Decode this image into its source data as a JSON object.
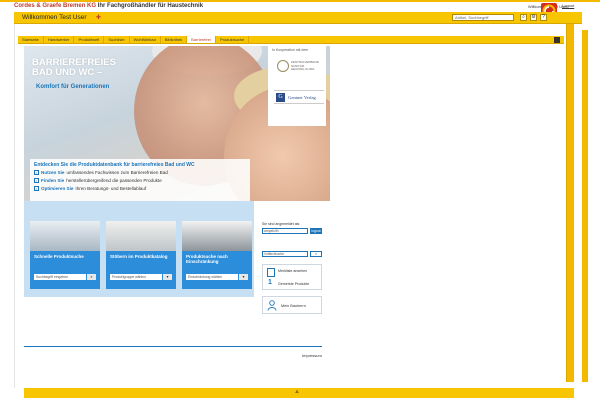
{
  "header": {
    "brand_name": "Cordes & Graefe Bremen KG",
    "brand_tagline": "Ihr Fachgroßhändler für Haustechnik",
    "login_status": "Willkommen Test User",
    "logout_label": "Logout",
    "welcome_text": "Willkommen Test User",
    "search_placeholder": "Artikel, Suchbegriff"
  },
  "nav": {
    "tabs": [
      {
        "label": "Startseite"
      },
      {
        "label": "Handwerker"
      },
      {
        "label": "Produktwelt"
      },
      {
        "label": "Suchliste"
      },
      {
        "label": "Wohlfühlbad"
      },
      {
        "label": "Bibliothek"
      },
      {
        "label": "Barrierefrei"
      },
      {
        "label": "Produktsuche"
      }
    ],
    "active_tab": "Barrierefrei"
  },
  "hero": {
    "headline_line1": "BARRIEREFREIES",
    "headline_line2": "BAD UND WC –",
    "subline": "Komfort für Generationen"
  },
  "discover": {
    "title": "Entdecken Sie die Produktdatenbank für barrierefreies Bad und WC",
    "items": [
      {
        "bold": "Nutzen Sie",
        "text": "umfassendes Fachwissen zum Barrierefreien Bad"
      },
      {
        "bold": "Finden Sie",
        "text": "herstellerübergreifend die passenden Produkte"
      },
      {
        "bold": "Optimieren Sie",
        "text": "Ihren Beratungs- und Bestellablauf"
      }
    ]
  },
  "cards": [
    {
      "title": "Schnelle Produktsuche",
      "input": "Suchbegriff eingeben"
    },
    {
      "title": "Stöbern im Produktkatalog",
      "input": "Produktgruppe wählen"
    },
    {
      "title": "Produktsuche nach Einschränkung",
      "input": "Einschränkung wählen"
    }
  ],
  "partner": {
    "cooperation": "In Kooperation mit dem",
    "seal_text": "ZENTRALVERBAND SANITÄR HEIZUNG KLIMA",
    "publisher": "Gentner Verlag"
  },
  "login_box": {
    "label": "Sie sind angemeldet als:",
    "username": "ampelc/lh",
    "button": "logout"
  },
  "fulltext": {
    "placeholder": "Volltextsuche"
  },
  "memo": {
    "open_label": "Merkliste ansehen",
    "count": "1",
    "count_label": "Gemerkte Produkte"
  },
  "advisor": {
    "label": "Mein Bauherrn"
  },
  "footer": {
    "impressum": "Impressum"
  }
}
